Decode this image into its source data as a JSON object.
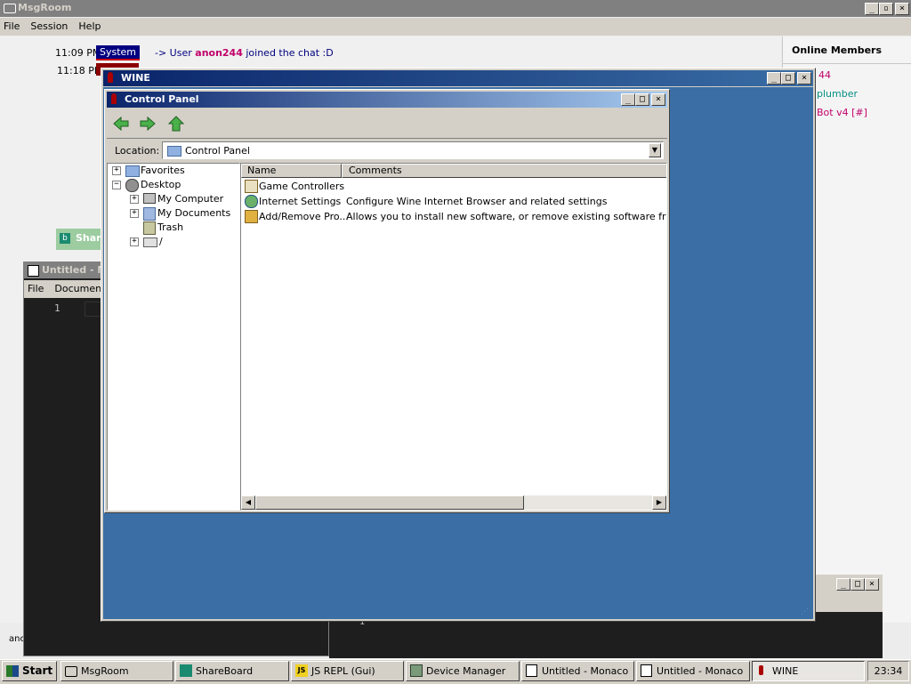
{
  "msgroom": {
    "title": "MsgRoom",
    "menu": [
      "File",
      "Session",
      "Help"
    ],
    "messages": [
      {
        "time": "11:09 PM",
        "badge": "System",
        "prefix": "-> User ",
        "user": "anon244",
        "suffix": " joined the chat :D"
      },
      {
        "time": "11:18 PM"
      }
    ],
    "online_header": "Online Members",
    "members_partial": [
      "44",
      "plumber",
      "Bot v4 [#]"
    ],
    "bottom_partial": "anc"
  },
  "shareboard": {
    "title_partial": "Share"
  },
  "monaco": {
    "title_partial": "Untitled - M",
    "menu": [
      "File",
      "Document"
    ],
    "line_number": "1",
    "second_line_number": "1"
  },
  "wine": {
    "title": "WINE",
    "colors": {
      "desktop": "#3a6ea5"
    }
  },
  "control_panel": {
    "title": "Control Panel",
    "location_label": "Location:",
    "location_value": "Control Panel",
    "tree": [
      {
        "label": "Favorites",
        "expander": "+",
        "icon": "folder-icon"
      },
      {
        "label": "Desktop",
        "expander": "−",
        "icon": "desktop-icon"
      },
      {
        "label": "My Computer",
        "expander": "+",
        "icon": "computer-icon"
      },
      {
        "label": "My Documents",
        "expander": "+",
        "icon": "documents-icon"
      },
      {
        "label": "Trash",
        "expander": "",
        "icon": "trash-icon"
      },
      {
        "label": "/",
        "expander": "+",
        "icon": "drive-icon"
      }
    ],
    "columns": [
      "Name",
      "Comments"
    ],
    "items": [
      {
        "name": "Game Controllers",
        "comment": "",
        "icon": "joystick-icon"
      },
      {
        "name": "Internet Settings",
        "comment": "Configure Wine Internet Browser and related settings",
        "icon": "globe-icon"
      },
      {
        "name": "Add/Remove Pro...",
        "comment": "Allows you to install new software, or remove existing software from your c",
        "icon": "package-icon"
      }
    ]
  },
  "taskbar": {
    "start": "Start",
    "tasks": [
      {
        "label": "MsgRoom",
        "icon": "chat-icon"
      },
      {
        "label": "ShareBoard",
        "icon": "shareboard-icon"
      },
      {
        "label": "JS REPL (Gui)",
        "icon": "js-icon"
      },
      {
        "label": "Device Manager",
        "icon": "device-manager-icon"
      },
      {
        "label": "Untitled - Monaco",
        "icon": "monaco-icon"
      },
      {
        "label": "Untitled - Monaco",
        "icon": "monaco-icon"
      },
      {
        "label": "WINE",
        "icon": "wine-icon"
      }
    ],
    "clock": "23:34"
  }
}
